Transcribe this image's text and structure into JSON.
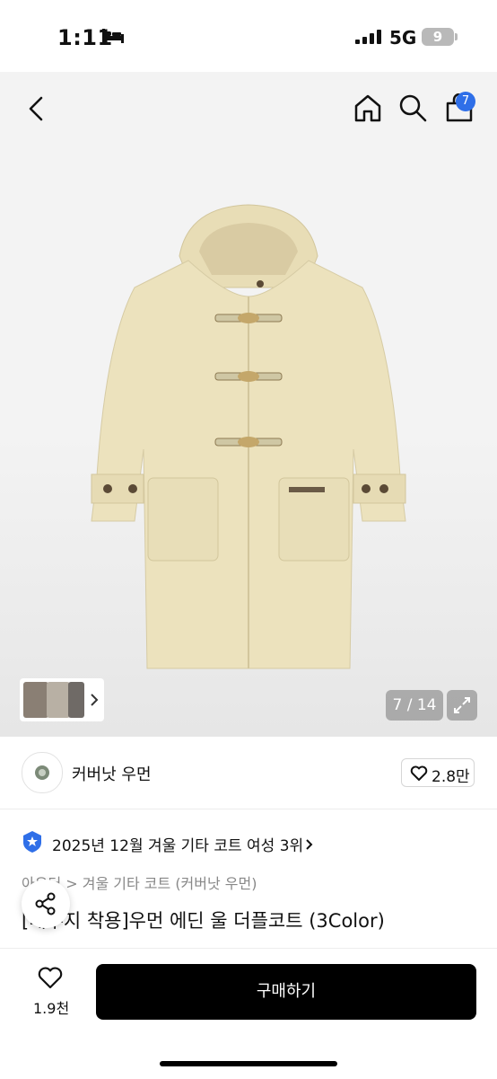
{
  "status_bar": {
    "time": "1:11",
    "network": "5G",
    "battery": "9"
  },
  "header": {
    "cart_badge": "7"
  },
  "gallery": {
    "counter": "7 / 14"
  },
  "brand": {
    "name": "커버낫 우먼",
    "likes": "2.8만"
  },
  "ranking": {
    "text": "2025년 12월 겨울 기타 코트 여성 3위"
  },
  "breadcrumb": "아우터 > 겨울 기타 코트 (커버낫 우먼)",
  "product": {
    "title": "[배우지 착용]우먼 에딘 울 더플코트 (3Color)"
  },
  "bottom": {
    "wish_count": "1.9천",
    "buy_label": "구매하기"
  },
  "colors": {
    "accent": "#2f6fe8",
    "coat": "#ece2bd",
    "buy_bg": "#000000"
  }
}
